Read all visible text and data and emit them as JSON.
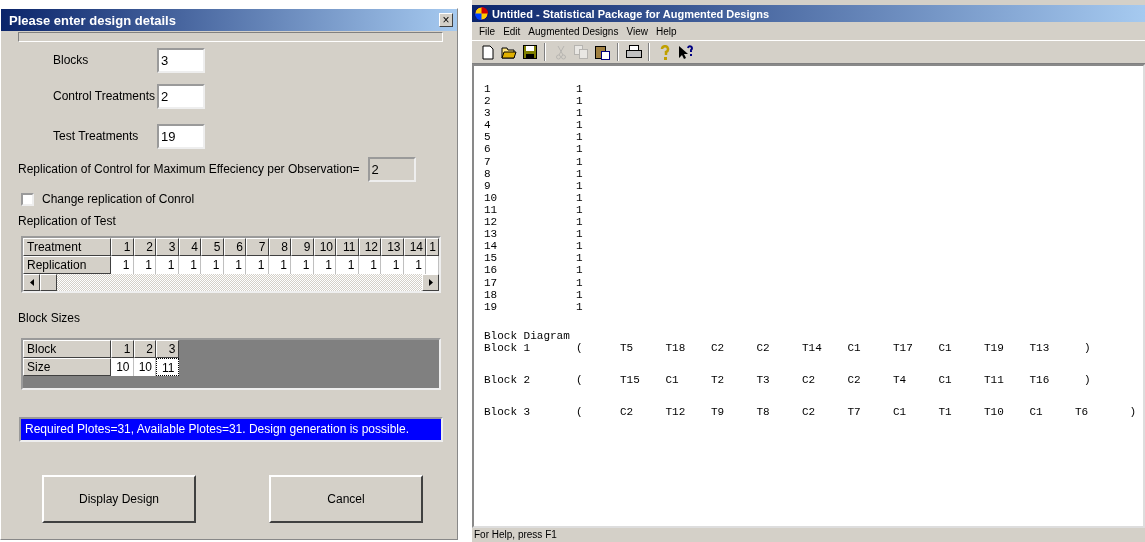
{
  "dialog": {
    "title": "Please enter design details",
    "close": "×",
    "fields": [
      {
        "label": "Blocks",
        "value": "3"
      },
      {
        "label": "Control Treatments",
        "value": "2"
      },
      {
        "label": "Test Treatments",
        "value": "19"
      }
    ],
    "replication_control": {
      "label": "Replication of Control for Maximum Effeciency per Observation=",
      "value": "2",
      "disabled": true
    },
    "change_replication": {
      "label": "Change replication of Conrol",
      "checked": false
    },
    "replication_of_test": {
      "title": "Replication of Test",
      "row_headers": [
        "Treatment",
        "Replication"
      ],
      "columns": [
        {
          "treatment": "1",
          "replication": "1"
        },
        {
          "treatment": "2",
          "replication": "1"
        },
        {
          "treatment": "3",
          "replication": "1"
        },
        {
          "treatment": "4",
          "replication": "1"
        },
        {
          "treatment": "5",
          "replication": "1"
        },
        {
          "treatment": "6",
          "replication": "1"
        },
        {
          "treatment": "7",
          "replication": "1"
        },
        {
          "treatment": "8",
          "replication": "1"
        },
        {
          "treatment": "9",
          "replication": "1"
        },
        {
          "treatment": "10",
          "replication": "1"
        },
        {
          "treatment": "11",
          "replication": "1"
        },
        {
          "treatment": "12",
          "replication": "1"
        },
        {
          "treatment": "13",
          "replication": "1"
        },
        {
          "treatment": "14",
          "replication": "1"
        },
        {
          "treatment": "1"
        }
      ]
    },
    "block_sizes": {
      "title": "Block Sizes",
      "row_headers": [
        "Block",
        "Size"
      ],
      "columns": [
        {
          "block": "1",
          "size": "10",
          "selected": false
        },
        {
          "block": "2",
          "size": "10",
          "selected": false
        },
        {
          "block": "3",
          "size": "11",
          "selected": true
        }
      ]
    },
    "message": "Required Plotes=31, Available Plotes=31. Design generation is possible.",
    "buttons": [
      "Display Design",
      "Cancel"
    ]
  },
  "app": {
    "title": "Untitled - Statistical Package for Augmented Designs",
    "menu": [
      "File",
      "Edit",
      "Augmented Designs",
      "View",
      "Help"
    ],
    "toolbar": [
      {
        "kind": "new",
        "disabled": false
      },
      {
        "kind": "open",
        "disabled": false
      },
      {
        "kind": "save",
        "disabled": false
      },
      {
        "kind": "sep"
      },
      {
        "kind": "cut",
        "disabled": true
      },
      {
        "kind": "copy",
        "disabled": true
      },
      {
        "kind": "paste",
        "disabled": false
      },
      {
        "kind": "sep"
      },
      {
        "kind": "print",
        "disabled": false
      },
      {
        "kind": "sep"
      },
      {
        "kind": "help",
        "disabled": false
      },
      {
        "kind": "context-help",
        "disabled": false
      }
    ],
    "output": {
      "listing": [
        [
          "1",
          "1"
        ],
        [
          "2",
          "1"
        ],
        [
          "3",
          "1"
        ],
        [
          "4",
          "1"
        ],
        [
          "5",
          "1"
        ],
        [
          "6",
          "1"
        ],
        [
          "7",
          "1"
        ],
        [
          "8",
          "1"
        ],
        [
          "9",
          "1"
        ],
        [
          "10",
          "1"
        ],
        [
          "11",
          "1"
        ],
        [
          "12",
          "1"
        ],
        [
          "13",
          "1"
        ],
        [
          "14",
          "1"
        ],
        [
          "15",
          "1"
        ],
        [
          "16",
          "1"
        ],
        [
          "17",
          "1"
        ],
        [
          "18",
          "1"
        ],
        [
          "19",
          "1"
        ]
      ],
      "block_diagram_title": "Block Diagram",
      "blocks": [
        {
          "label": "Block 1",
          "open": "(",
          "items": [
            "T5",
            "T18",
            "C2",
            "C2",
            "T14",
            "C1",
            "T17",
            "C1",
            "T19",
            "T13"
          ],
          "close": ")"
        },
        {
          "label": "Block 2",
          "open": "(",
          "items": [
            "T15",
            "C1",
            "T2",
            "T3",
            "C2",
            "C2",
            "T4",
            "C1",
            "T11",
            "T16"
          ],
          "close": ")"
        },
        {
          "label": "Block 3",
          "open": "(",
          "items": [
            "C2",
            "T12",
            "T9",
            "T8",
            "C2",
            "T7",
            "C1",
            "T1",
            "T10",
            "C1",
            "T6"
          ],
          "close": ")"
        }
      ]
    },
    "status_bar": "For Help, press F1"
  }
}
